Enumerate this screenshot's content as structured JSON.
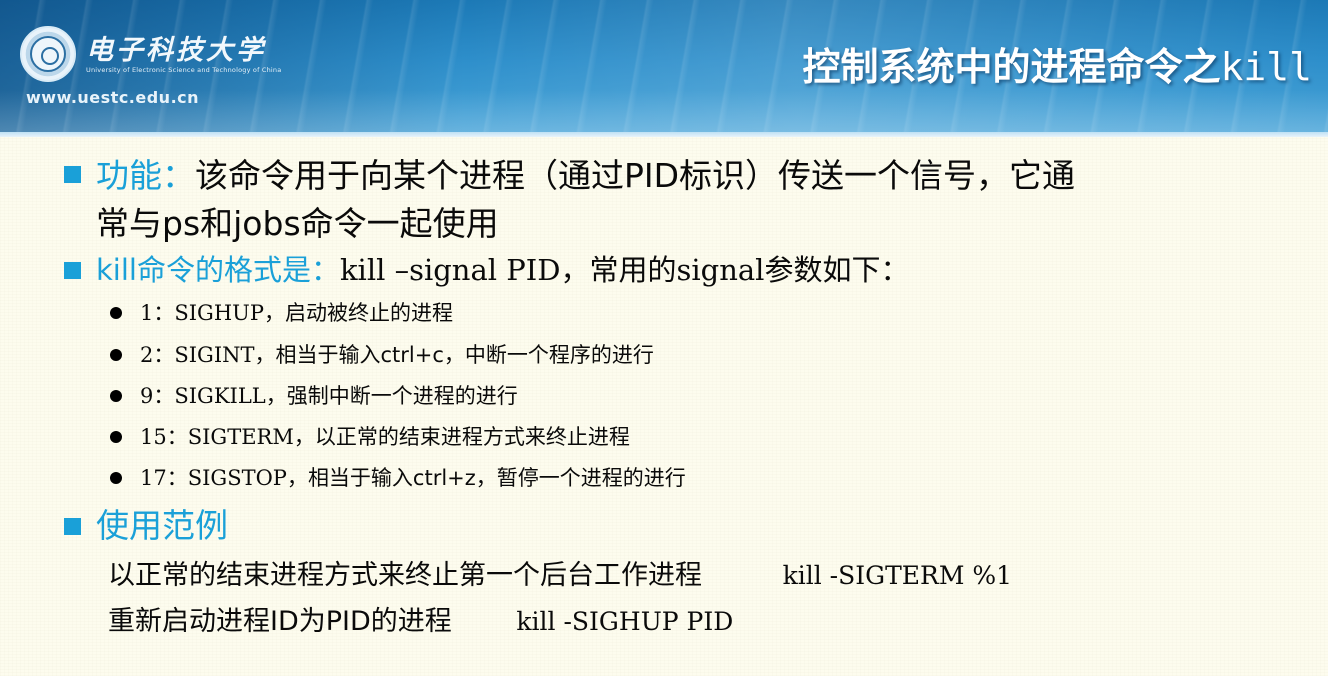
{
  "header": {
    "university_name": "电子科技大学",
    "university_en": "University of Electronic Science and Technology of China",
    "url": "www.uestc.edu.cn",
    "title_cn": "控制系统中的进程命令之",
    "title_cmd": "kill"
  },
  "sections": {
    "function": {
      "label": "功能：",
      "line1": "该命令用于向某个进程（通过PID标识）传送一个信号，它通",
      "line2": "常与ps和jobs命令一起使用"
    },
    "format": {
      "label": "kill命令的格式是：",
      "text": "kill –signal PID，常用的signal参数如下："
    },
    "signals": [
      {
        "num": "1：",
        "name": "SIGHUP，",
        "desc": "启动被终止的进程"
      },
      {
        "num": "2：",
        "name": "SIGINT，",
        "desc": "相当于输入ctrl+c，中断一个程序的进行"
      },
      {
        "num": "9：",
        "name": "SIGKILL，",
        "desc": "强制中断一个进程的进行"
      },
      {
        "num": "15：",
        "name": "SIGTERM，",
        "desc": "以正常的结束进程方式来终止进程"
      },
      {
        "num": "17：",
        "name": "SIGSTOP，",
        "desc": "相当于输入ctrl+z，暂停一个进程的进行"
      }
    ],
    "examples": {
      "label": "使用范例",
      "items": [
        {
          "desc": "以正常的结束进程方式来终止第一个后台工作进程",
          "cmd": "kill -SIGTERM %1"
        },
        {
          "desc": "重新启动进程ID为PID的进程",
          "cmd": "kill -SIGHUP PID"
        }
      ]
    }
  },
  "colors": {
    "accent": "#1aa0d8",
    "header_blue": "#2e8fcb",
    "background": "#fdfcee"
  }
}
